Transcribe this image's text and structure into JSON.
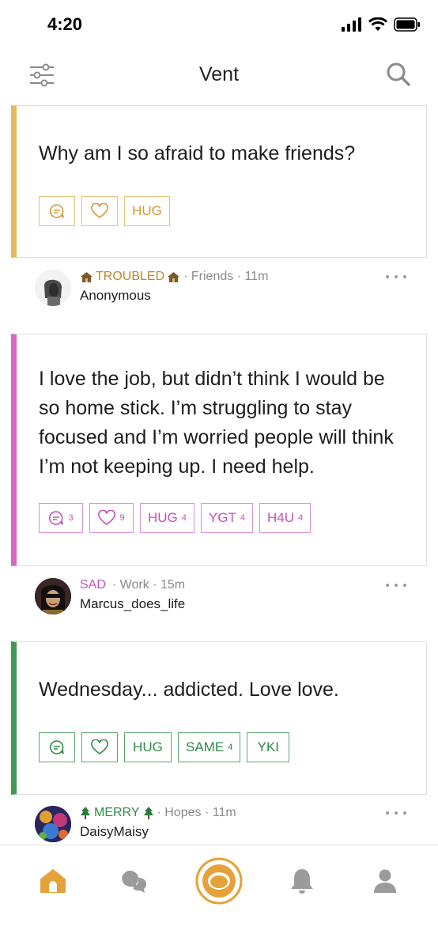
{
  "status": {
    "time": "4:20"
  },
  "nav": {
    "title": "Vent",
    "left_icon": "filter-sliders-icon",
    "right_icon": "search-icon"
  },
  "posts": [
    {
      "text": "Why am I so afraid to make friends?",
      "accent": "#e8b95a",
      "chip_color": "#d19a32",
      "chips": {
        "hug": "HUG"
      },
      "meta": {
        "mood": "TROUBLED",
        "mood_color": "#c4862a",
        "mood_emoji": "house-icon",
        "sub": "· Friends · 11m",
        "user": "Anonymous"
      }
    },
    {
      "text": "I love the job, but didn’t think I would be so home stick. I’m struggling to stay focused and I’m worried people will think I’m not keeping up. I need help.",
      "accent": "#d766c7",
      "chip_color": "#c84fb8",
      "chips": {
        "comments": "3",
        "likes": "9",
        "hug": "HUG",
        "hug_count": "4",
        "ygt": "YGT",
        "ygt_count": "4",
        "h4u": "H4U",
        "h4u_count": "4"
      },
      "meta": {
        "mood": "SAD",
        "mood_color": "#c84fb8",
        "sub": "· Work · 15m",
        "user": "Marcus_does_life"
      }
    },
    {
      "text": "Wednesday... addicted. Love love.",
      "accent": "#3f9a55",
      "chip_color": "#2f8a45",
      "chips": {
        "hug": "HUG",
        "same": "SAME",
        "same_count": "4",
        "yki": "YKI"
      },
      "meta": {
        "mood": "MERRY",
        "mood_color": "#2f8a45",
        "mood_emoji": "tree-icon",
        "sub": "· Hopes · 11m",
        "user": "DaisyMaisy"
      }
    }
  ],
  "tabs": [
    "home",
    "messages",
    "vent",
    "notifications",
    "profile"
  ],
  "colors": {
    "brand": "#e5a13a",
    "tab_inactive": "#9b9b9b"
  }
}
